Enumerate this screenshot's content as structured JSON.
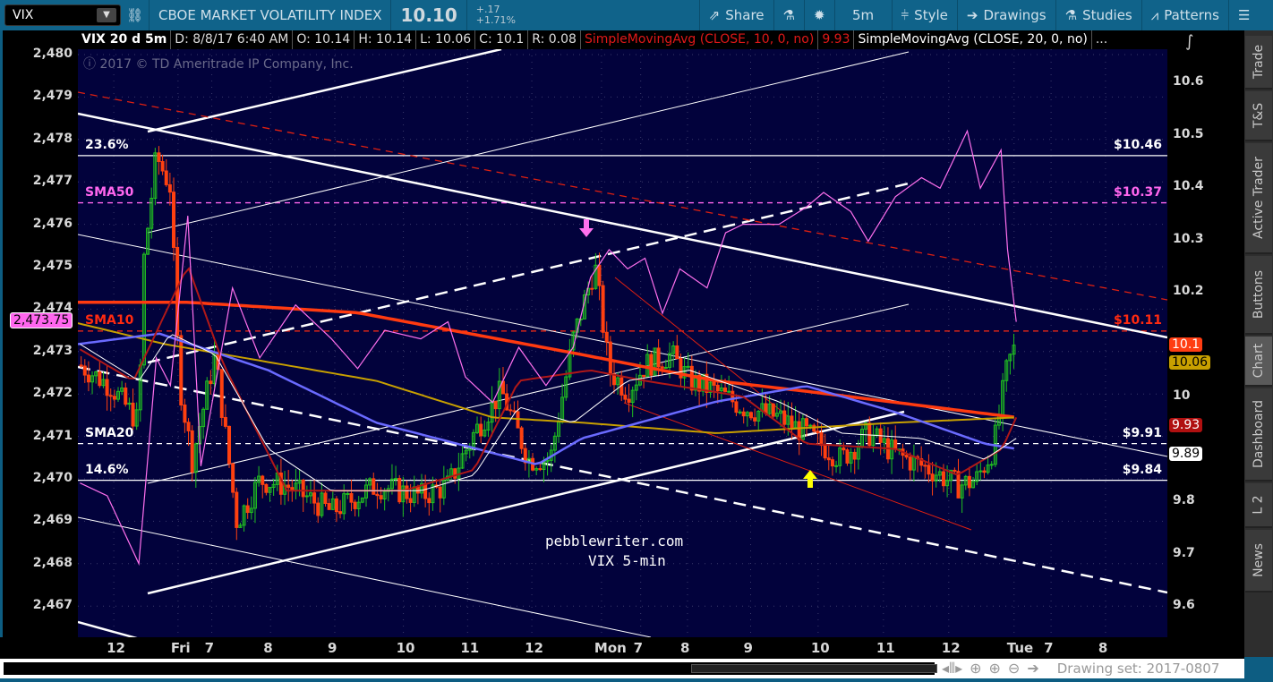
{
  "toolbar": {
    "symbol": "VIX",
    "title": "CBOE MARKET VOLATILITY INDEX",
    "last": "10.10",
    "change": "+.17",
    "change_pct": "+1.71%",
    "share": "Share",
    "interval": "5m",
    "style": "Style",
    "drawings": "Drawings",
    "studies": "Studies",
    "patterns": "Patterns"
  },
  "legend": {
    "name": "VIX 20 d 5m",
    "date": "D: 8/8/17 6:40 AM",
    "open": "O: 10.14",
    "high": "H: 10.14",
    "low": "L: 10.06",
    "close": "C: 10.1",
    "range": "R: 0.08",
    "sma10": "SimpleMovingAvg (CLOSE, 10, 0, no)",
    "sma10_val": "9.93",
    "sma20": "SimpleMovingAvg (CLOSE, 20, 0, no)",
    "more": "..."
  },
  "copyright": "2017 © TD Ameritrade IP Company, Inc.",
  "watermark": {
    "line1": "pebblewriter.com",
    "line2": "VIX 5-min"
  },
  "left_axis": {
    "ticks": [
      "2,480",
      "2,479",
      "2,478",
      "2,477",
      "2,476",
      "2,475",
      "2,474",
      "2,473",
      "2,472",
      "2,471",
      "2,470",
      "2,469",
      "2,468",
      "2,467"
    ],
    "tag": "2,473.75"
  },
  "right_axis": {
    "ticks": [
      "10.6",
      "10.5",
      "10.4",
      "10.3",
      "10.2",
      "10",
      "9.8",
      "9.7",
      "9.6"
    ],
    "tags": [
      {
        "text": "10.1",
        "bg": "#ff3d12",
        "fg": "#ffffff",
        "price": 10.1
      },
      {
        "text": "10.06",
        "bg": "#c8a000",
        "fg": "#000000",
        "price": 10.065
      },
      {
        "text": "9.93",
        "bg": "#b01010",
        "fg": "#ffffff",
        "price": 9.945
      },
      {
        "text": "9.89",
        "bg": "#ffffff",
        "fg": "#000000",
        "price": 9.89
      }
    ]
  },
  "levels": [
    {
      "left": "23.6%",
      "right": "$10.46",
      "price": 10.46,
      "color": "#ffffff",
      "dash": false
    },
    {
      "left": "SMA50",
      "right": "$10.37",
      "price": 10.37,
      "color": "#ff66ee",
      "dash": true
    },
    {
      "left": "SMA10",
      "right": "$10.11",
      "price": 10.125,
      "color": "#ff2a10",
      "dash": true
    },
    {
      "left": "SMA20",
      "right": "$9.91",
      "price": 9.91,
      "color": "#ffffff",
      "dash": true
    },
    {
      "left": "14.6%",
      "right": "$9.84",
      "price": 9.84,
      "color": "#ffffff",
      "dash": false
    }
  ],
  "x_axis": {
    "labels": [
      "12",
      "Fri",
      "7",
      "8",
      "9",
      "10",
      "11",
      "12",
      "Mon",
      "7",
      "8",
      "9",
      "10",
      "11",
      "12",
      "Tue",
      "7",
      "8"
    ],
    "label_t": [
      3.3,
      9.2,
      12.3,
      17.7,
      23.6,
      29.9,
      35.8,
      41.7,
      48.1,
      51.7,
      56,
      61.8,
      68,
      74,
      80,
      86,
      89.4,
      94.4
    ]
  },
  "sidebar": {
    "tabs": [
      "Trade",
      "T&S",
      "Active Trader",
      "Buttons",
      "Chart",
      "Dashboard",
      "L 2",
      "News"
    ],
    "active": "Chart"
  },
  "bottom": {
    "drawing_set": "Drawing set: 2017-0807"
  },
  "chart_data": {
    "type": "candlestick",
    "title": "VIX 20 d 5m",
    "t_range": [
      0,
      100
    ],
    "ylim_right": [
      9.55,
      10.65
    ],
    "ylim_left": [
      2466.5,
      2480.2
    ],
    "vix_close": [
      [
        0.2,
        10.06
      ],
      [
        3,
        10.02
      ],
      [
        5.6,
        9.95
      ],
      [
        6,
        10.25
      ],
      [
        7.2,
        10.46
      ],
      [
        8.5,
        10.4
      ],
      [
        9.3,
        10.03
      ],
      [
        10.5,
        9.88
      ],
      [
        12.6,
        10.08
      ],
      [
        14.6,
        9.76
      ],
      [
        16.7,
        9.84
      ],
      [
        19.2,
        9.83
      ],
      [
        23.3,
        9.78
      ],
      [
        27.4,
        9.83
      ],
      [
        31.5,
        9.81
      ],
      [
        34,
        9.83
      ],
      [
        36.4,
        9.93
      ],
      [
        38.9,
        10.01
      ],
      [
        41.4,
        9.88
      ],
      [
        43.4,
        9.88
      ],
      [
        45.5,
        10.11
      ],
      [
        47.5,
        10.25
      ],
      [
        48.8,
        10.05
      ],
      [
        50.5,
        10.01
      ],
      [
        52.1,
        10.06
      ],
      [
        54.5,
        10.08
      ],
      [
        56.2,
        10.03
      ],
      [
        58.6,
        10.01
      ],
      [
        61.1,
        9.98
      ],
      [
        64.4,
        9.96
      ],
      [
        66.9,
        9.93
      ],
      [
        70.1,
        9.88
      ],
      [
        72.6,
        9.93
      ],
      [
        75.1,
        9.89
      ],
      [
        78.4,
        9.86
      ],
      [
        80.8,
        9.83
      ],
      [
        82.5,
        9.84
      ],
      [
        84.1,
        9.9
      ],
      [
        85.4,
        10.06
      ],
      [
        86.2,
        10.1
      ]
    ],
    "spx_overlay": [
      [
        0.2,
        2469.9
      ],
      [
        2.7,
        2469.6
      ],
      [
        5.6,
        2468
      ],
      [
        7.2,
        2472.85
      ],
      [
        8.5,
        2472.2
      ],
      [
        10.1,
        2476.2
      ],
      [
        11.3,
        2470.3
      ],
      [
        14.2,
        2474.5
      ],
      [
        16.7,
        2472.85
      ],
      [
        20,
        2474.1
      ],
      [
        23.3,
        2473.3
      ],
      [
        25.7,
        2472.6
      ],
      [
        28.2,
        2473.5
      ],
      [
        31.5,
        2473.3
      ],
      [
        34,
        2473.7
      ],
      [
        35.6,
        2472.4
      ],
      [
        38.1,
        2471.8
      ],
      [
        40.5,
        2473.1
      ],
      [
        43,
        2472.2
      ],
      [
        45.5,
        2473.1
      ],
      [
        47.1,
        2474.75
      ],
      [
        48.8,
        2475.4
      ],
      [
        50.5,
        2474.95
      ],
      [
        52.1,
        2475.2
      ],
      [
        53.7,
        2473.9
      ],
      [
        55.3,
        2474.95
      ],
      [
        57.8,
        2474.5
      ],
      [
        59.5,
        2475.8
      ],
      [
        61.1,
        2476
      ],
      [
        64.4,
        2476
      ],
      [
        66.9,
        2476.4
      ],
      [
        68.5,
        2476.75
      ],
      [
        71,
        2476.3
      ],
      [
        72.6,
        2475.6
      ],
      [
        75.1,
        2476.65
      ],
      [
        77.5,
        2477.1
      ],
      [
        79.2,
        2476.85
      ],
      [
        81.7,
        2478.2
      ],
      [
        82.9,
        2476.85
      ],
      [
        84.8,
        2477.75
      ],
      [
        85.4,
        2475.4
      ],
      [
        86.2,
        2473.7
      ]
    ],
    "series": [
      {
        "name": "SMA long (red)",
        "color": "#ff3a10",
        "width": 3.5,
        "points": [
          [
            0,
            10.18
          ],
          [
            10,
            10.18
          ],
          [
            25.7,
            10.16
          ],
          [
            46.3,
            10.08
          ],
          [
            58.6,
            10.03
          ],
          [
            66.9,
            10.01
          ],
          [
            86.2,
            9.96
          ]
        ]
      },
      {
        "name": "SMA (gold)",
        "color": "#c8a000",
        "width": 2,
        "points": [
          [
            0,
            10.14
          ],
          [
            8,
            10.1
          ],
          [
            27.4,
            10.03
          ],
          [
            38.1,
            9.96
          ],
          [
            46.3,
            9.95
          ],
          [
            58.6,
            9.93
          ],
          [
            75.1,
            9.95
          ],
          [
            86.2,
            9.96
          ]
        ]
      },
      {
        "name": "SMA50 (blue)",
        "color": "#6a6aff",
        "width": 2.5,
        "points": [
          [
            0,
            10.1
          ],
          [
            7.5,
            10.12
          ],
          [
            17.5,
            10.05
          ],
          [
            27.4,
            9.95
          ],
          [
            42.2,
            9.87
          ],
          [
            46.3,
            9.92
          ],
          [
            58.6,
            9.99
          ],
          [
            66.9,
            10.02
          ],
          [
            75.1,
            9.97
          ],
          [
            83.3,
            9.91
          ],
          [
            86.2,
            9.9
          ]
        ]
      },
      {
        "name": "SMA10 (dark red)",
        "color": "#b01818",
        "width": 2,
        "points": [
          [
            0.2,
            10.09
          ],
          [
            5.1,
            10.03
          ],
          [
            10.1,
            10.25
          ],
          [
            13.4,
            10.06
          ],
          [
            19.2,
            9.82
          ],
          [
            29.9,
            9.82
          ],
          [
            36.4,
            9.86
          ],
          [
            40.5,
            10.03
          ],
          [
            47.1,
            10.05
          ],
          [
            52.1,
            10.03
          ],
          [
            61.1,
            10
          ],
          [
            66.9,
            9.91
          ],
          [
            75.1,
            9.9
          ],
          [
            80.8,
            9.85
          ],
          [
            84.9,
            9.9
          ],
          [
            86.2,
            9.96
          ]
        ]
      },
      {
        "name": "SMA20 (white)",
        "color": "#ffffff",
        "width": 1,
        "points": [
          [
            0.2,
            10.1
          ],
          [
            5.6,
            10.03
          ],
          [
            8.5,
            10.12
          ],
          [
            12.6,
            10.08
          ],
          [
            17.5,
            9.9
          ],
          [
            23.3,
            9.82
          ],
          [
            31.5,
            9.82
          ],
          [
            36.4,
            9.85
          ],
          [
            40.5,
            9.98
          ],
          [
            45.5,
            9.95
          ],
          [
            50.5,
            10.03
          ],
          [
            56.2,
            10.05
          ],
          [
            64.4,
            9.99
          ],
          [
            70.1,
            9.93
          ],
          [
            77.5,
            9.92
          ],
          [
            83.3,
            9.88
          ],
          [
            86.2,
            9.92
          ]
        ]
      }
    ]
  }
}
